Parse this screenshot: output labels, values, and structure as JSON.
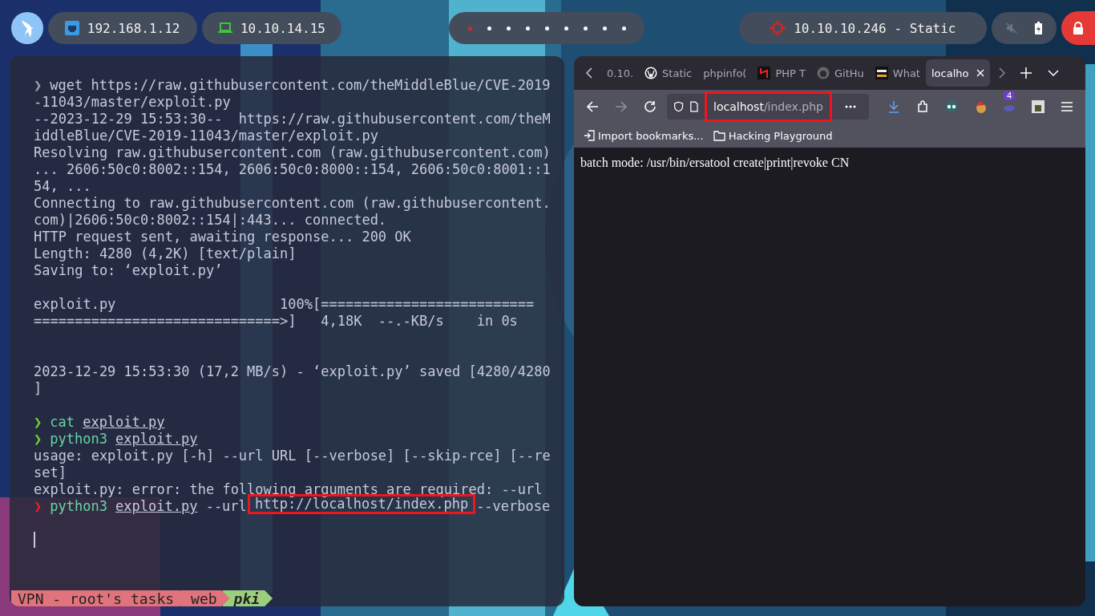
{
  "top_bar": {
    "interfaces": [
      {
        "kind": "ethernet",
        "address": "192.168.1.12"
      },
      {
        "kind": "laptop",
        "address": "10.10.14.15"
      }
    ],
    "workspaces": [
      {
        "selected": true
      },
      {
        "selected": false
      },
      {
        "selected": false
      },
      {
        "selected": false
      },
      {
        "selected": false
      },
      {
        "selected": false
      },
      {
        "selected": false
      },
      {
        "selected": false
      },
      {
        "selected": false
      }
    ],
    "target": "10.10.10.246 - Static",
    "muted": true
  },
  "terminal": {
    "lines": [
      {
        "kind": "prompt-past",
        "prompt": "❯",
        "segments": [
          {
            "kind": "argument",
            "text": "wget https://raw.githubusercontent.com/theMiddleBlue/CVE-2019"
          }
        ]
      },
      {
        "kind": "output",
        "text": "-11043/master/exploit.py"
      },
      {
        "kind": "output",
        "text": "--2023-12-29 15:53:30--  https://raw.githubusercontent.com/theM"
      },
      {
        "kind": "output",
        "text": "iddleBlue/CVE-2019-11043/master/exploit.py"
      },
      {
        "kind": "output",
        "text": "Resolving raw.githubusercontent.com (raw.githubusercontent.com)"
      },
      {
        "kind": "output",
        "text": "... 2606:50c0:8002::154, 2606:50c0:8000::154, 2606:50c0:8001::1"
      },
      {
        "kind": "output",
        "text": "54, ..."
      },
      {
        "kind": "output",
        "text": "Connecting to raw.githubusercontent.com (raw.githubusercontent."
      },
      {
        "kind": "output",
        "text": "com)|2606:50c0:8002::154|:443... connected."
      },
      {
        "kind": "output",
        "text": "HTTP request sent, awaiting response... 200 OK"
      },
      {
        "kind": "output",
        "text": "Length: 4280 (4,2K) [text/plain]"
      },
      {
        "kind": "output",
        "text": "Saving to: ‘exploit.py’"
      },
      {
        "kind": "blank"
      },
      {
        "kind": "output",
        "text": "exploit.py                    100%[=========================="
      },
      {
        "kind": "output",
        "text": "==============================>]   4,18K  --.-KB/s    in 0s"
      },
      {
        "kind": "blank"
      },
      {
        "kind": "blank"
      },
      {
        "kind": "output",
        "text": "2023-12-29 15:53:30 (17,2 MB/s) - ‘exploit.py’ saved [4280/4280"
      },
      {
        "kind": "output",
        "text": "]"
      },
      {
        "kind": "blank"
      },
      {
        "kind": "prompt-ok",
        "prompt": "❯",
        "segments": [
          {
            "kind": "command",
            "text": "cat"
          },
          {
            "kind": "path",
            "text": "exploit.py"
          }
        ]
      },
      {
        "kind": "prompt-ok",
        "prompt": "❯",
        "segments": [
          {
            "kind": "command",
            "text": "python3"
          },
          {
            "kind": "path",
            "text": "exploit.py"
          }
        ]
      },
      {
        "kind": "output",
        "text": "usage: exploit.py [-h] --url URL [--verbose] [--skip-rce] [--re"
      },
      {
        "kind": "output",
        "text": "set]"
      },
      {
        "kind": "output",
        "text": "exploit.py: error: the following arguments are required: --url"
      },
      {
        "kind": "prompt-error",
        "prompt": "❯",
        "segments": [
          {
            "kind": "command",
            "text": "python3"
          },
          {
            "kind": "path",
            "text": "exploit.py"
          },
          {
            "kind": "argument",
            "text": "--url"
          },
          {
            "kind": "argument",
            "text": "http://localhost/index.php",
            "highlighted": true
          },
          {
            "kind": "argument",
            "text": "--verbose"
          }
        ]
      },
      {
        "kind": "blank"
      },
      {
        "kind": "cursor"
      }
    ],
    "status_line": [
      {
        "text": "VPN - root's tasks",
        "color": "#e0737b"
      },
      {
        "text": "web",
        "color": "#e0737b"
      },
      {
        "text": "pki",
        "color": "#9ccf7c"
      }
    ]
  },
  "browser": {
    "tabs": [
      {
        "title": "0.10.",
        "kind": "plain",
        "selected": false
      },
      {
        "title": "Static",
        "kind": "wordpress",
        "selected": false
      },
      {
        "title": "phpinfo(",
        "kind": "plain",
        "selected": false
      },
      {
        "title": "PHP T",
        "kind": "hmark",
        "selected": false
      },
      {
        "title": "GitHu",
        "kind": "github",
        "selected": false
      },
      {
        "title": "What",
        "kind": "squarelogo",
        "selected": false
      },
      {
        "title": "localho",
        "kind": "plain",
        "selected": true
      }
    ],
    "address": {
      "host": "localhost",
      "path": "/index.php",
      "highlighted": true
    },
    "extension_badge": "4",
    "bookmarks": [
      {
        "kind": "import",
        "label": "Import bookmarks..."
      },
      {
        "kind": "folder",
        "label": "Hacking Playground"
      }
    ],
    "page_text": "batch mode: /usr/bin/ersatool create|print|revoke CN"
  }
}
